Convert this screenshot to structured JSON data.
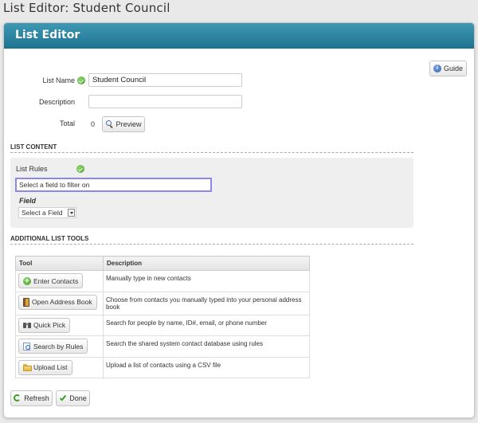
{
  "page_title": "List Editor: Student Council",
  "card": {
    "title": "List Editor"
  },
  "guide_button": {
    "label": "Guide",
    "icon": "info-icon"
  },
  "form": {
    "list_name_label": "List Name",
    "list_name_value": "Student Council",
    "description_label": "Description",
    "description_value": "",
    "total_label": "Total",
    "total_value": "0",
    "preview_label": "Preview"
  },
  "list_content": {
    "heading": "LIST CONTENT",
    "rules_label": "List Rules",
    "filter_text": "Select a field to filter on",
    "field_label": "Field",
    "field_select_value": "Select a Field"
  },
  "tools": {
    "heading": "ADDITIONAL LIST TOOLS",
    "columns": [
      "Tool",
      "Description"
    ],
    "rows": [
      {
        "label": "Enter Contacts",
        "icon": "add-icon",
        "description": "Manually type in new contacts"
      },
      {
        "label": "Open Address Book",
        "icon": "address-book-icon",
        "description": "Choose from contacts you manually typed into your personal address book"
      },
      {
        "label": "Quick Pick",
        "icon": "binoculars-icon",
        "description": "Search for people by name, ID#, email, or phone number"
      },
      {
        "label": "Search by Rules",
        "icon": "search-rules-icon",
        "description": "Search the shared system contact database using rules"
      },
      {
        "label": "Upload List",
        "icon": "folder-icon",
        "description": "Upload a list of contacts using a CSV file"
      }
    ]
  },
  "footer": {
    "refresh_label": "Refresh",
    "done_label": "Done"
  },
  "colors": {
    "header_blue": "#2a86a3",
    "check_green": "#4caf2f",
    "focus_border": "#8c88e6"
  }
}
